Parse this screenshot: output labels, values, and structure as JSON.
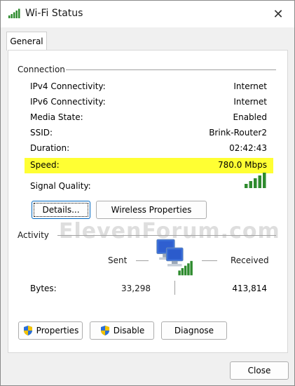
{
  "window": {
    "title": "Wi-Fi Status",
    "close_glyph": "✕"
  },
  "tabs": [
    {
      "label": "General"
    }
  ],
  "connection": {
    "section_label": "Connection",
    "rows": [
      {
        "label": "IPv4 Connectivity:",
        "value": "Internet"
      },
      {
        "label": "IPv6 Connectivity:",
        "value": "Internet"
      },
      {
        "label": "Media State:",
        "value": "Enabled"
      },
      {
        "label": "SSID:",
        "value": "Brink-Router2"
      },
      {
        "label": "Duration:",
        "value": "02:42:43"
      },
      {
        "label": "Speed:",
        "value": "780.0 Mbps"
      }
    ],
    "signal_label": "Signal Quality:",
    "signal_bars_filled": 5,
    "signal_bars_total": 5,
    "details_button": "Details...",
    "wireless_button": "Wireless Properties"
  },
  "activity": {
    "section_label": "Activity",
    "sent_label": "Sent",
    "received_label": "Received",
    "bytes_label": "Bytes:",
    "bytes_sent": "33,298",
    "bytes_received": "413,814"
  },
  "buttons": {
    "properties": "Properties",
    "disable": "Disable",
    "diagnose": "Diagnose",
    "close": "Close"
  },
  "watermark": "ElevenForum.com",
  "colors": {
    "highlight": "#ffff33",
    "signal_green": "#2e8b2e",
    "accent": "#0067c0"
  },
  "icons": {
    "title": "wifi-signal-icon",
    "shield": "uac-shield-icon",
    "network": "network-computers-icon"
  }
}
